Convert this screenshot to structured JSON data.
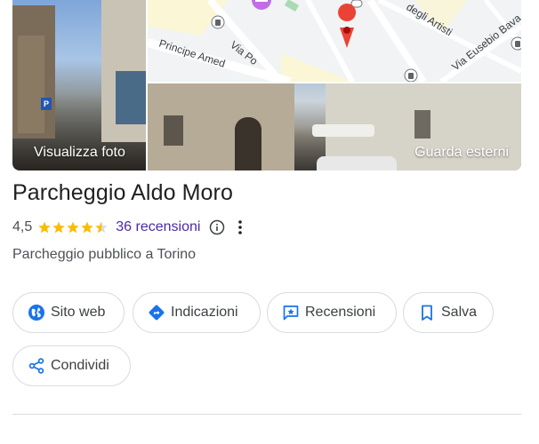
{
  "media": {
    "photo_label": "Visualizza foto",
    "exterior_label": "Guarda esterni",
    "map": {
      "streets": [
        "Via Po",
        "Principe Amed",
        "degli Artisti",
        "Via Eusebio Bava"
      ]
    }
  },
  "place": {
    "name": "Parcheggio Aldo Moro",
    "rating": "4,5",
    "rating_value": 4.5,
    "rating_max": 5,
    "reviews": "36 recensioni",
    "category": "Parcheggio pubblico a Torino"
  },
  "actions": {
    "website": "Sito web",
    "directions": "Indicazioni",
    "reviews": "Recensioni",
    "save": "Salva",
    "share": "Condividi"
  },
  "colors": {
    "star": "#fbbc04",
    "link": "#4b2aa5",
    "icon_blue": "#1a73e8",
    "directions_icon": "#1a73e8",
    "pin": "#ea4335",
    "map_pin_poi": "#c26ce6"
  },
  "icons": {
    "info": "info-icon",
    "more": "more-vert-icon",
    "website": "globe-icon",
    "directions": "directions-icon",
    "reviews": "review-star-icon",
    "save": "bookmark-icon",
    "share": "share-icon"
  }
}
